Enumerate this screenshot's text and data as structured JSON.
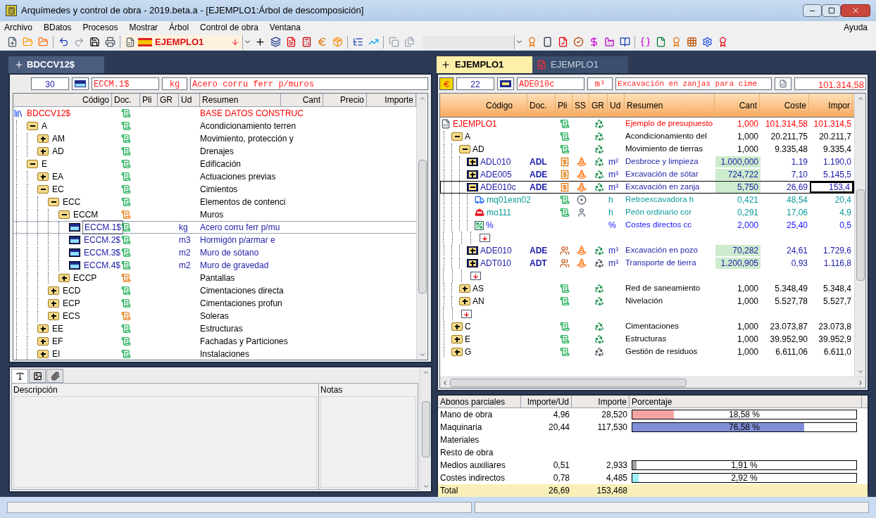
{
  "window": {
    "title": "Arquímedes y control de obra - 2019.beta.a - [EJEMPLO1:Árbol de descomposición]"
  },
  "menu": [
    "Archivo",
    "BDatos",
    "Procesos",
    "Mostrar",
    "Árbol",
    "Control de obra",
    "Ventana"
  ],
  "menu_right": "Ayuda",
  "toolbar": {
    "project": "EJEMPLO1"
  },
  "left_panel": {
    "tab": "BDCCV12$",
    "info": {
      "count": "30",
      "code": "ECCM.1$",
      "unit": "kg",
      "summary": "Acero corru ferr p/muros"
    },
    "columns": [
      "Código",
      "Doc.",
      "Pli",
      "GR",
      "Ud",
      "Resumen",
      "Cant",
      "Precio",
      "Importe"
    ],
    "tree": [
      {
        "kind": "root",
        "code": "BDCCV12$",
        "doc_complete": true,
        "summary": "BASE DATOS CONSTRUC",
        "selected": false,
        "children": [
          {
            "kind": "chapter",
            "code": "A",
            "doc_complete": true,
            "summary": "Acondicionamiento terren",
            "expanded": true,
            "selected": false,
            "children": [
              {
                "kind": "chapter",
                "code": "AM",
                "doc_complete": true,
                "summary": "Movimiento, protección y",
                "expanded": false,
                "selected": false
              },
              {
                "kind": "chapter",
                "code": "AD",
                "doc_complete": true,
                "summary": "Drenajes",
                "expanded": false,
                "selected": false
              }
            ]
          },
          {
            "kind": "chapter",
            "code": "E",
            "doc_complete": true,
            "summary": "Edificación",
            "expanded": true,
            "selected": false,
            "children": [
              {
                "kind": "chapter",
                "code": "EA",
                "doc_complete": true,
                "summary": "Actuaciones previas",
                "expanded": false,
                "selected": false
              },
              {
                "kind": "chapter",
                "code": "EC",
                "doc_complete": true,
                "summary": "Cimientos",
                "expanded": true,
                "selected": false,
                "children": [
                  {
                    "kind": "chapter",
                    "code": "ECC",
                    "doc_complete": true,
                    "summary": "Elementos de contenci",
                    "expanded": true,
                    "selected": false,
                    "children": [
                      {
                        "kind": "chapter",
                        "code": "ECCM",
                        "doc_complete": false,
                        "summary": "Muros",
                        "expanded": true,
                        "selected": false,
                        "children": [
                          {
                            "kind": "item",
                            "code": "ECCM.1$",
                            "doc_complete": true,
                            "unit": "kg",
                            "summary": "Acero corru ferr p/mu",
                            "selected": true
                          },
                          {
                            "kind": "item",
                            "code": "ECCM.2$",
                            "doc_complete": true,
                            "unit": "m3",
                            "summary": "Hormigón p/armar e",
                            "selected": false
                          },
                          {
                            "kind": "item",
                            "code": "ECCM.3$",
                            "doc_complete": true,
                            "unit": "m2",
                            "summary": "Muro de sótano",
                            "selected": false
                          },
                          {
                            "kind": "item",
                            "code": "ECCM.4$",
                            "doc_complete": true,
                            "unit": "m2",
                            "summary": "Muro de gravedad",
                            "selected": false
                          }
                        ]
                      },
                      {
                        "kind": "chapter",
                        "code": "ECCP",
                        "doc_complete": false,
                        "summary": "Pantallas",
                        "expanded": false,
                        "selected": false
                      }
                    ]
                  },
                  {
                    "kind": "chapter",
                    "code": "ECD",
                    "doc_complete": true,
                    "summary": "Cimentaciones directa",
                    "expanded": false,
                    "selected": false
                  },
                  {
                    "kind": "chapter",
                    "code": "ECP",
                    "doc_complete": true,
                    "summary": "Cimentaciones profun",
                    "expanded": false,
                    "selected": false
                  },
                  {
                    "kind": "chapter",
                    "code": "ECS",
                    "doc_complete": false,
                    "summary": "Soleras",
                    "expanded": false,
                    "selected": false
                  }
                ]
              },
              {
                "kind": "chapter",
                "code": "EE",
                "doc_complete": true,
                "summary": "Estructuras",
                "expanded": false,
                "selected": false
              },
              {
                "kind": "chapter",
                "code": "EF",
                "doc_complete": true,
                "summary": "Fachadas y Particiones",
                "expanded": false,
                "selected": false
              },
              {
                "kind": "chapter",
                "code": "EI",
                "doc_complete": true,
                "summary": "Instalaciones",
                "expanded": false,
                "selected": false
              }
            ]
          }
        ]
      }
    ]
  },
  "right_panel": {
    "tabs": [
      {
        "label": "EJEMPLO1",
        "selected": true
      },
      {
        "label": "EJEMPLO1",
        "selected": false
      }
    ],
    "info": {
      "count": "22",
      "code": "ADE010c",
      "unit": "m³",
      "summary": "Excavación en zanjas para cime",
      "total": "101.314,58"
    },
    "columns": [
      "Código",
      "Doc.",
      "Pli",
      "SS",
      "GR",
      "Ud",
      "Resumen",
      "Cant",
      "Coste",
      "Impor"
    ],
    "tree": [
      {
        "kind": "root",
        "code": "EJEMPLO1",
        "pli": {
          "kind": "scroll"
        },
        "recycled": true,
        "summary": "Ejemplo de presupuesto",
        "cant": "1,000",
        "cost": "101.314,58",
        "amount": "101.314,5",
        "selected": false,
        "children": [
          {
            "kind": "chapter",
            "code": "A",
            "pli": {
              "kind": "scroll"
            },
            "recycled": true,
            "summary": "Acondicionamiento del",
            "cant": "1,000",
            "cost": "20.211,75",
            "amount": "20.211,7",
            "expanded": true,
            "selected": false,
            "children": [
              {
                "kind": "chapter",
                "code": "AD",
                "pli": {
                  "kind": "scroll"
                },
                "recycled": true,
                "summary": "Movimiento de tierras",
                "cant": "1,000",
                "cost": "9.335,48",
                "amount": "9.335,4",
                "expanded": true,
                "selected": false,
                "children": [
                  {
                    "kind": "item",
                    "code": "ADL010",
                    "doc_code": "ADL",
                    "pli": {
                      "kind": "budget"
                    },
                    "ss": {
                      "kind": "cone"
                    },
                    "recycled": true,
                    "unit": "m²",
                    "summary": "Desbroce y limpieza",
                    "cant": "1.000,000",
                    "measured": true,
                    "cost": "1,19",
                    "amount": "1.190,0",
                    "expanded": false,
                    "selected": false
                  },
                  {
                    "kind": "item",
                    "code": "ADE005",
                    "doc_code": "ADE",
                    "pli": {
                      "kind": "budget"
                    },
                    "ss": {
                      "kind": "cone"
                    },
                    "recycled": true,
                    "unit": "m³",
                    "summary": "Excavación de sótar",
                    "cant": "724,722",
                    "measured": true,
                    "cost": "7,10",
                    "amount": "5.145,5",
                    "expanded": false,
                    "selected": false
                  },
                  {
                    "kind": "item",
                    "code": "ADE010c",
                    "doc_code": "ADE",
                    "pli": {
                      "kind": "budget"
                    },
                    "ss": {
                      "kind": "cone"
                    },
                    "recycled": true,
                    "unit": "m³",
                    "summary": "Excavación en zanja",
                    "cant": "5,750",
                    "measured": true,
                    "cost": "26,69",
                    "amount": "153,4",
                    "expanded": true,
                    "selected": true,
                    "children": [
                      {
                        "kind": "machine",
                        "code": "mq01exn02",
                        "pli": {
                          "kind": "scroll"
                        },
                        "ss": {
                          "kind": "wheel"
                        },
                        "unit": "h",
                        "summary": "Retroexcavadora h",
                        "cant": "0,421",
                        "cost": "48,54",
                        "amount": "20,4",
                        "selected": false
                      },
                      {
                        "kind": "labor",
                        "code": "mo111",
                        "pli": {
                          "kind": "scroll"
                        },
                        "ss": {
                          "kind": "worker"
                        },
                        "unit": "h",
                        "summary": "Peón ordinario cor",
                        "cant": "0,291",
                        "cost": "17,06",
                        "amount": "4,9",
                        "selected": false
                      },
                      {
                        "kind": "percent",
                        "code": "%",
                        "unit": "%",
                        "summary": "Costes directos cc",
                        "cant": "2,000",
                        "cost": "25,40",
                        "amount": "0,5",
                        "selected": false
                      },
                      {
                        "kind": "end"
                      }
                    ]
                  },
                  {
                    "kind": "item",
                    "code": "ADE010",
                    "doc_code": "ADE",
                    "pli": {
                      "kind": "split"
                    },
                    "ss": {
                      "kind": "cone"
                    },
                    "recycled": true,
                    "unit": "m³",
                    "summary": "Excavación en pozo",
                    "cant": "70,282",
                    "measured": true,
                    "cost": "24,61",
                    "amount": "1.729,6",
                    "expanded": false,
                    "selected": false
                  },
                  {
                    "kind": "item",
                    "code": "ADT010",
                    "doc_code": "ADT",
                    "pli": {
                      "kind": "split"
                    },
                    "ss": {
                      "kind": "cone"
                    },
                    "recycled": false,
                    "unit": "m³",
                    "summary": "Transporte de tierra",
                    "cant": "1.200,905",
                    "measured": true,
                    "cost": "0,93",
                    "amount": "1.116,8",
                    "expanded": false,
                    "selected": false
                  },
                  {
                    "kind": "end"
                  }
                ]
              },
              {
                "kind": "chapter",
                "code": "AS",
                "pli": {
                  "kind": "scroll"
                },
                "recycled": true,
                "summary": "Red de saneamiento",
                "cant": "1,000",
                "cost": "5.348,49",
                "amount": "5.348,4",
                "expanded": false,
                "selected": false
              },
              {
                "kind": "chapter",
                "code": "AN",
                "pli": {
                  "kind": "scroll"
                },
                "recycled": true,
                "summary": "Nivelación",
                "cant": "1,000",
                "cost": "5.527,78",
                "amount": "5.527,7",
                "expanded": false,
                "selected": false
              },
              {
                "kind": "end"
              }
            ]
          },
          {
            "kind": "chapter",
            "code": "C",
            "pli": {
              "kind": "scroll"
            },
            "recycled": true,
            "summary": "Cimentaciones",
            "cant": "1,000",
            "cost": "23.073,87",
            "amount": "23.073,8",
            "expanded": false,
            "selected": false
          },
          {
            "kind": "chapter",
            "code": "E",
            "pli": {
              "kind": "scroll"
            },
            "recycled": true,
            "summary": "Estructuras",
            "cant": "1,000",
            "cost": "39.952,90",
            "amount": "39.952,9",
            "expanded": false,
            "selected": false
          },
          {
            "kind": "chapter",
            "code": "G",
            "pli": {
              "kind": "scroll"
            },
            "recycled": false,
            "summary": "Gestión de residuos",
            "cant": "1,000",
            "cost": "6.611,06",
            "amount": "6.611,0",
            "expanded": false,
            "selected": false
          }
        ]
      }
    ]
  },
  "notes_panel": {
    "tabs": [
      {
        "kind": "text",
        "selected": true
      },
      {
        "kind": "image",
        "selected": false
      },
      {
        "kind": "attachment",
        "selected": false
      }
    ],
    "columns": [
      "Descripción",
      "Notas"
    ]
  },
  "breakdown": {
    "columns": [
      "Abonos parciales",
      "Importe/Ud",
      "Importe",
      "Porcentaje"
    ],
    "rows": [
      {
        "name": "Mano de obra",
        "unit_amount": "4,96",
        "amount": "28,520",
        "percent": "18,58 %",
        "level": 0.1858,
        "color": "#f4a4a4"
      },
      {
        "name": "Maquinaria",
        "unit_amount": "20,44",
        "amount": "117,530",
        "percent": "76,58 %",
        "level": 0.7658,
        "color": "#8090d8"
      },
      {
        "name": "Materiales"
      },
      {
        "name": "Resto de obra"
      },
      {
        "name": "Medios auxiliares",
        "unit_amount": "0,51",
        "amount": "2,933",
        "percent": "1,91 %",
        "level": 0.0191,
        "color": "#a0a0a0"
      },
      {
        "name": "Costes indirectos",
        "unit_amount": "0,78",
        "amount": "4,485",
        "percent": "2,92 %",
        "level": 0.0292,
        "color": "#a0f0f8"
      }
    ],
    "total": {
      "name": "Total",
      "unit_amount": "26,69",
      "amount": "153,468"
    }
  }
}
